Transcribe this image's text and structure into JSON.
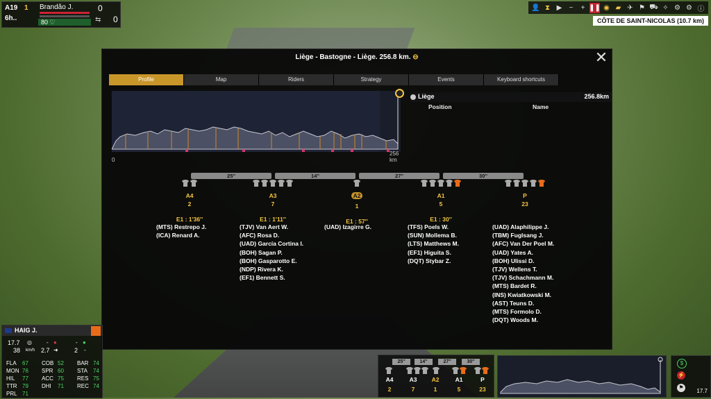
{
  "hud": {
    "stage_code": "A19",
    "time_short": "6h..",
    "rank": "1",
    "rider_name": "Brandão J.",
    "energy": "80",
    "count_top": "0",
    "count_bottom": "0"
  },
  "climb_label": "CÔTE DE SAINT-NICOLAS (10.7 km)",
  "modal": {
    "title": "Liège - Bastogne - Liège. 256.8 km.",
    "close": "✕",
    "tabs": [
      "Profile",
      "Map",
      "Riders",
      "Strategy",
      "Events",
      "Keyboard shortcuts"
    ],
    "active_tab": 0,
    "profile_start": "0",
    "profile_end": "256 km",
    "finish_name": "Liège",
    "finish_km": "256.8km",
    "col_position": "Position",
    "col_name": "Name"
  },
  "gaps": [
    "25''",
    "14''",
    "27''",
    "30''"
  ],
  "groups": [
    {
      "name": "A4",
      "count": "2",
      "time": "E1 : 1'36''",
      "jerseys": 2,
      "orange": false,
      "highlight": false,
      "riders": [
        "(MTS) Restrepo J.",
        "(ICA) Renard A."
      ]
    },
    {
      "name": "A3",
      "count": "7",
      "time": "E1 : 1'11''",
      "jerseys": 5,
      "orange": false,
      "highlight": false,
      "riders": [
        "(TJV) Van Aert W.",
        "(AFC) Rosa D.",
        "(UAD) García Cortina I.",
        "(BOH) Sagan P.",
        "(BOH) Gasparotto E.",
        "(NDP) Rivera K.",
        "(EF1) Bennett S."
      ]
    },
    {
      "name": "A2",
      "count": "1",
      "time": "E1 : 57''",
      "jerseys": 1,
      "orange": false,
      "highlight": true,
      "riders": [
        "(UAD) Izagirre G."
      ]
    },
    {
      "name": "A1",
      "count": "5",
      "time": "E1 : 30''",
      "jerseys": 5,
      "orange": true,
      "highlight": false,
      "riders": [
        "(TFS) Poels W.",
        "(SUN) Mollema B.",
        "(LTS) Matthews M.",
        "(EF1) Higuita S.",
        "(DQT) Stybar Z."
      ]
    },
    {
      "name": "P",
      "count": "23",
      "time": "",
      "jerseys": 5,
      "orange": true,
      "highlight": false,
      "riders": [
        "(UAD) Alaphilippe J.",
        "(TBM) Fuglsang J.",
        "(AFC) Van Der Poel M.",
        "(UAD) Yates A.",
        "(BOH) Ulissi D.",
        "(TJV) Wellens T.",
        "(TJV) Schachmann M.",
        "(MTS) Bardet R.",
        "(INS) Kwiatkowski M.",
        "(AST) Teuns D.",
        "(MTS) Formolo D.",
        "(DQT) Woods M."
      ]
    }
  ],
  "rider_panel": {
    "name": "HAIG J.",
    "speed": "17.7",
    "speed2": "38",
    "unit": "km/h",
    "v1": "2.7",
    "v2": "2",
    "dash1": "-",
    "dash2": "-",
    "dash3": "-",
    "stats": [
      {
        "k": "FLA",
        "v": "67"
      },
      {
        "k": "COB",
        "v": "52"
      },
      {
        "k": "BAR",
        "v": "74"
      },
      {
        "k": "MON",
        "v": "76"
      },
      {
        "k": "SPR",
        "v": "60"
      },
      {
        "k": "STA",
        "v": "74"
      },
      {
        "k": "HIL",
        "v": "77"
      },
      {
        "k": "ACC",
        "v": "75"
      },
      {
        "k": "RES",
        "v": "75"
      },
      {
        "k": "TTR",
        "v": "79"
      },
      {
        "k": "DHI",
        "v": "71"
      },
      {
        "k": "REC",
        "v": "74"
      },
      {
        "k": "PRL",
        "v": "71"
      }
    ]
  },
  "bottom": {
    "gaps": [
      "25''",
      "14''",
      "27''",
      "30''"
    ],
    "groups": [
      "A4",
      "A3",
      "A2",
      "A1",
      "P"
    ],
    "counts": [
      "2",
      "7",
      "1",
      "5",
      "23"
    ]
  },
  "right_panel": {
    "speed": "17.7"
  }
}
